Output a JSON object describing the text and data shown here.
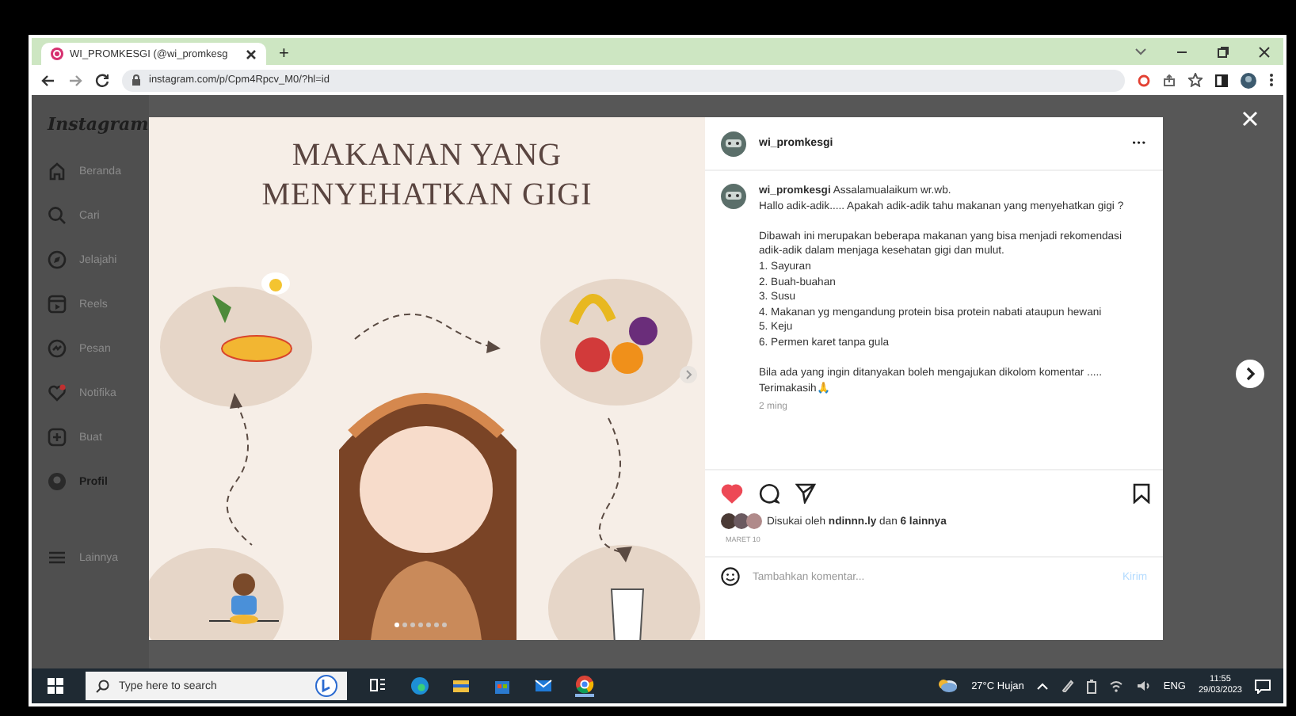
{
  "browser": {
    "tab_title": "WI_PROMKESGI (@wi_promkesg",
    "new_tab": "+",
    "url": "instagram.com/p/Cpm4Rpcv_M0/?hl=id"
  },
  "sidebar": {
    "logo": "Instagram",
    "items": [
      {
        "label": "Beranda",
        "selected": false
      },
      {
        "label": "Cari",
        "selected": false
      },
      {
        "label": "Jelajahi",
        "selected": false
      },
      {
        "label": "Reels",
        "selected": false
      },
      {
        "label": "Pesan",
        "selected": false
      },
      {
        "label": "Notifika",
        "selected": false
      },
      {
        "label": "Buat",
        "selected": false
      },
      {
        "label": "Profil",
        "selected": true
      },
      {
        "label": "Lainnya",
        "selected": false
      }
    ]
  },
  "post": {
    "image_title": "MAKANAN YANG\nMENYEHATKAN GIGI",
    "slides": [
      {
        "selected": true
      },
      {
        "selected": false
      },
      {
        "selected": false
      },
      {
        "selected": false
      },
      {
        "selected": false
      },
      {
        "selected": false
      },
      {
        "selected": false
      }
    ],
    "username": "wi_promkesgi",
    "more": "•••",
    "caption": "**wi_promkesgi** Assalamualaikum wr.wb.\nHallo adik-adik..... Apakah adik-adik tahu makanan yang menyehatkan gigi ?\n\nDibawah ini merupakan beberapa makanan yang bisa menjadi rekomendasi adik-adik dalam menjaga kesehatan gigi dan mulut.\n1. Sayuran\n2. Buah-buahan\n3. Susu\n4. Makanan yg mengandung protein bisa protein nabati ataupun hewani\n5. Keju\n6. Permen karet tanpa gula\n\nBila ada yang ingin ditanyakan boleh mengajukan dikolom komentar .....\nTerimakasih🙏",
    "caption_time": "2 ming",
    "liked": true,
    "likes": "Disukai oleh **ndinnn.ly** dan **6 lainnya**",
    "date": "MARET 10",
    "comment_placeholder": "Tambahkan komentar...",
    "post_button": "Kirim"
  },
  "taskbar": {
    "search_placeholder": "Type here to search",
    "weather": "27°C  Hujan",
    "language": "ENG",
    "time": "11:55",
    "date": "29/03/2023"
  }
}
